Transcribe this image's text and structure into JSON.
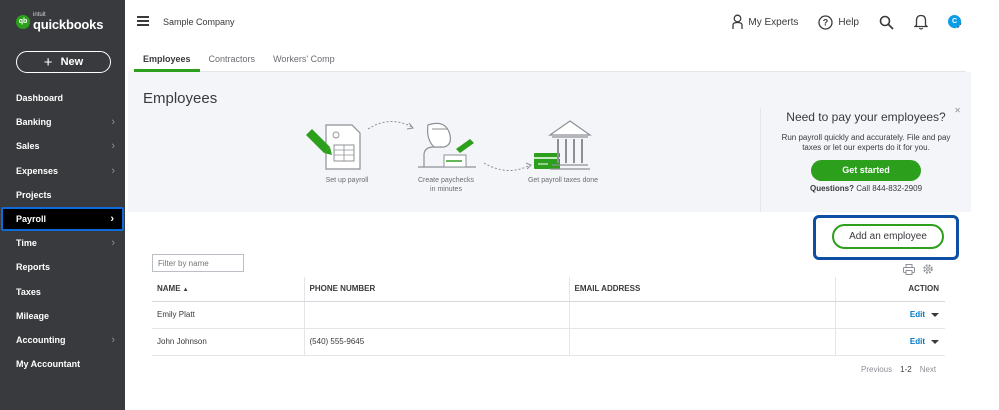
{
  "brand": {
    "mark": "qb",
    "sub": "intuit",
    "name": "quickbooks"
  },
  "sidebar": {
    "new_label": "New",
    "items": [
      {
        "label": "Dashboard",
        "chevron": false
      },
      {
        "label": "Banking",
        "chevron": true
      },
      {
        "label": "Sales",
        "chevron": true
      },
      {
        "label": "Expenses",
        "chevron": true
      },
      {
        "label": "Projects",
        "chevron": false
      },
      {
        "label": "Payroll",
        "chevron": true,
        "active": true
      },
      {
        "label": "Time",
        "chevron": true
      },
      {
        "label": "Reports",
        "chevron": false
      },
      {
        "label": "Taxes",
        "chevron": false
      },
      {
        "label": "Mileage",
        "chevron": false
      },
      {
        "label": "Accounting",
        "chevron": true
      },
      {
        "label": "My Accountant",
        "chevron": false
      }
    ]
  },
  "header": {
    "company": "Sample Company",
    "experts_label": "My Experts",
    "help_label": "Help",
    "avatar_initial": "C"
  },
  "tabs": [
    {
      "label": "Employees",
      "active": true
    },
    {
      "label": "Contractors",
      "active": false
    },
    {
      "label": "Workers' Comp",
      "active": false
    }
  ],
  "banner": {
    "title": "Employees",
    "steps": [
      "Set up payroll",
      "Create paychecks\nin minutes",
      "Get payroll taxes done"
    ],
    "promo": {
      "heading": "Need to pay your employees?",
      "body": "Run payroll quickly and accurately. File and pay taxes or let our experts do it for you.",
      "cta": "Get started",
      "questions_bold": "Questions?",
      "questions_rest": " Call 844-832-2909"
    }
  },
  "add_employee_label": "Add an employee",
  "filter": {
    "placeholder": "Filter by name"
  },
  "table": {
    "columns": [
      "NAME",
      "PHONE NUMBER",
      "EMAIL ADDRESS",
      "ACTION"
    ],
    "rows": [
      {
        "name": "Emily Platt",
        "phone": "",
        "email": "",
        "action": "Edit"
      },
      {
        "name": "John Johnson",
        "phone": "(540) 555-9645",
        "email": "",
        "action": "Edit"
      }
    ]
  },
  "pager": {
    "prev": "Previous",
    "range": "1-2",
    "next": "Next"
  },
  "colors": {
    "sidebar": "#393a3d",
    "brand_green": "#2ca01c",
    "highlight_blue": "#0d4fa3",
    "link": "#0077c5"
  }
}
